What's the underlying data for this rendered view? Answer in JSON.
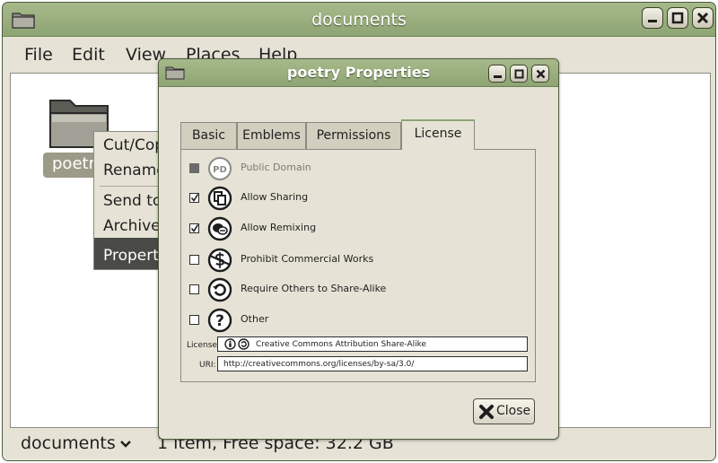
{
  "window": {
    "title": "documents"
  },
  "menubar": {
    "items": [
      "File",
      "Edit",
      "View",
      "Places",
      "Help"
    ]
  },
  "file_item": {
    "label": "poetr"
  },
  "context_menu": {
    "items": [
      "Cut/Cop",
      "Rename",
      "Send to",
      "Archive",
      "Properti"
    ]
  },
  "statusbar": {
    "location": "documents",
    "info": "1 item, Free space: 32.2 GB"
  },
  "dialog": {
    "title": "poetry Properties",
    "tabs": [
      "Basic",
      "Emblems",
      "Permissions",
      "License"
    ],
    "active_tab": "License",
    "license_options": [
      {
        "label": "Public Domain",
        "checked": false,
        "disabled": true,
        "icon": "public-domain-icon"
      },
      {
        "label": "Allow Sharing",
        "checked": true,
        "disabled": false,
        "icon": "sharing-icon"
      },
      {
        "label": "Allow Remixing",
        "checked": true,
        "disabled": false,
        "icon": "remix-icon"
      },
      {
        "label": "Prohibit Commercial Works",
        "checked": false,
        "disabled": false,
        "icon": "noncommercial-icon"
      },
      {
        "label": "Require Others to Share-Alike",
        "checked": false,
        "disabled": false,
        "icon": "share-alike-icon"
      },
      {
        "label": "Other",
        "checked": false,
        "disabled": false,
        "icon": "question-icon"
      }
    ],
    "license_label": "License:",
    "license_value": "Creative Commons Attribution Share-Alike",
    "uri_label": "URI:",
    "uri_value": "http://creativecommons.org/licenses/by-sa/3.0/",
    "close_label": "Close",
    "public_domain_badge": "PD"
  },
  "colors": {
    "titlebar": "#8ea474",
    "window_bg": "#e6e3d6",
    "selection": "#4a4a48"
  }
}
